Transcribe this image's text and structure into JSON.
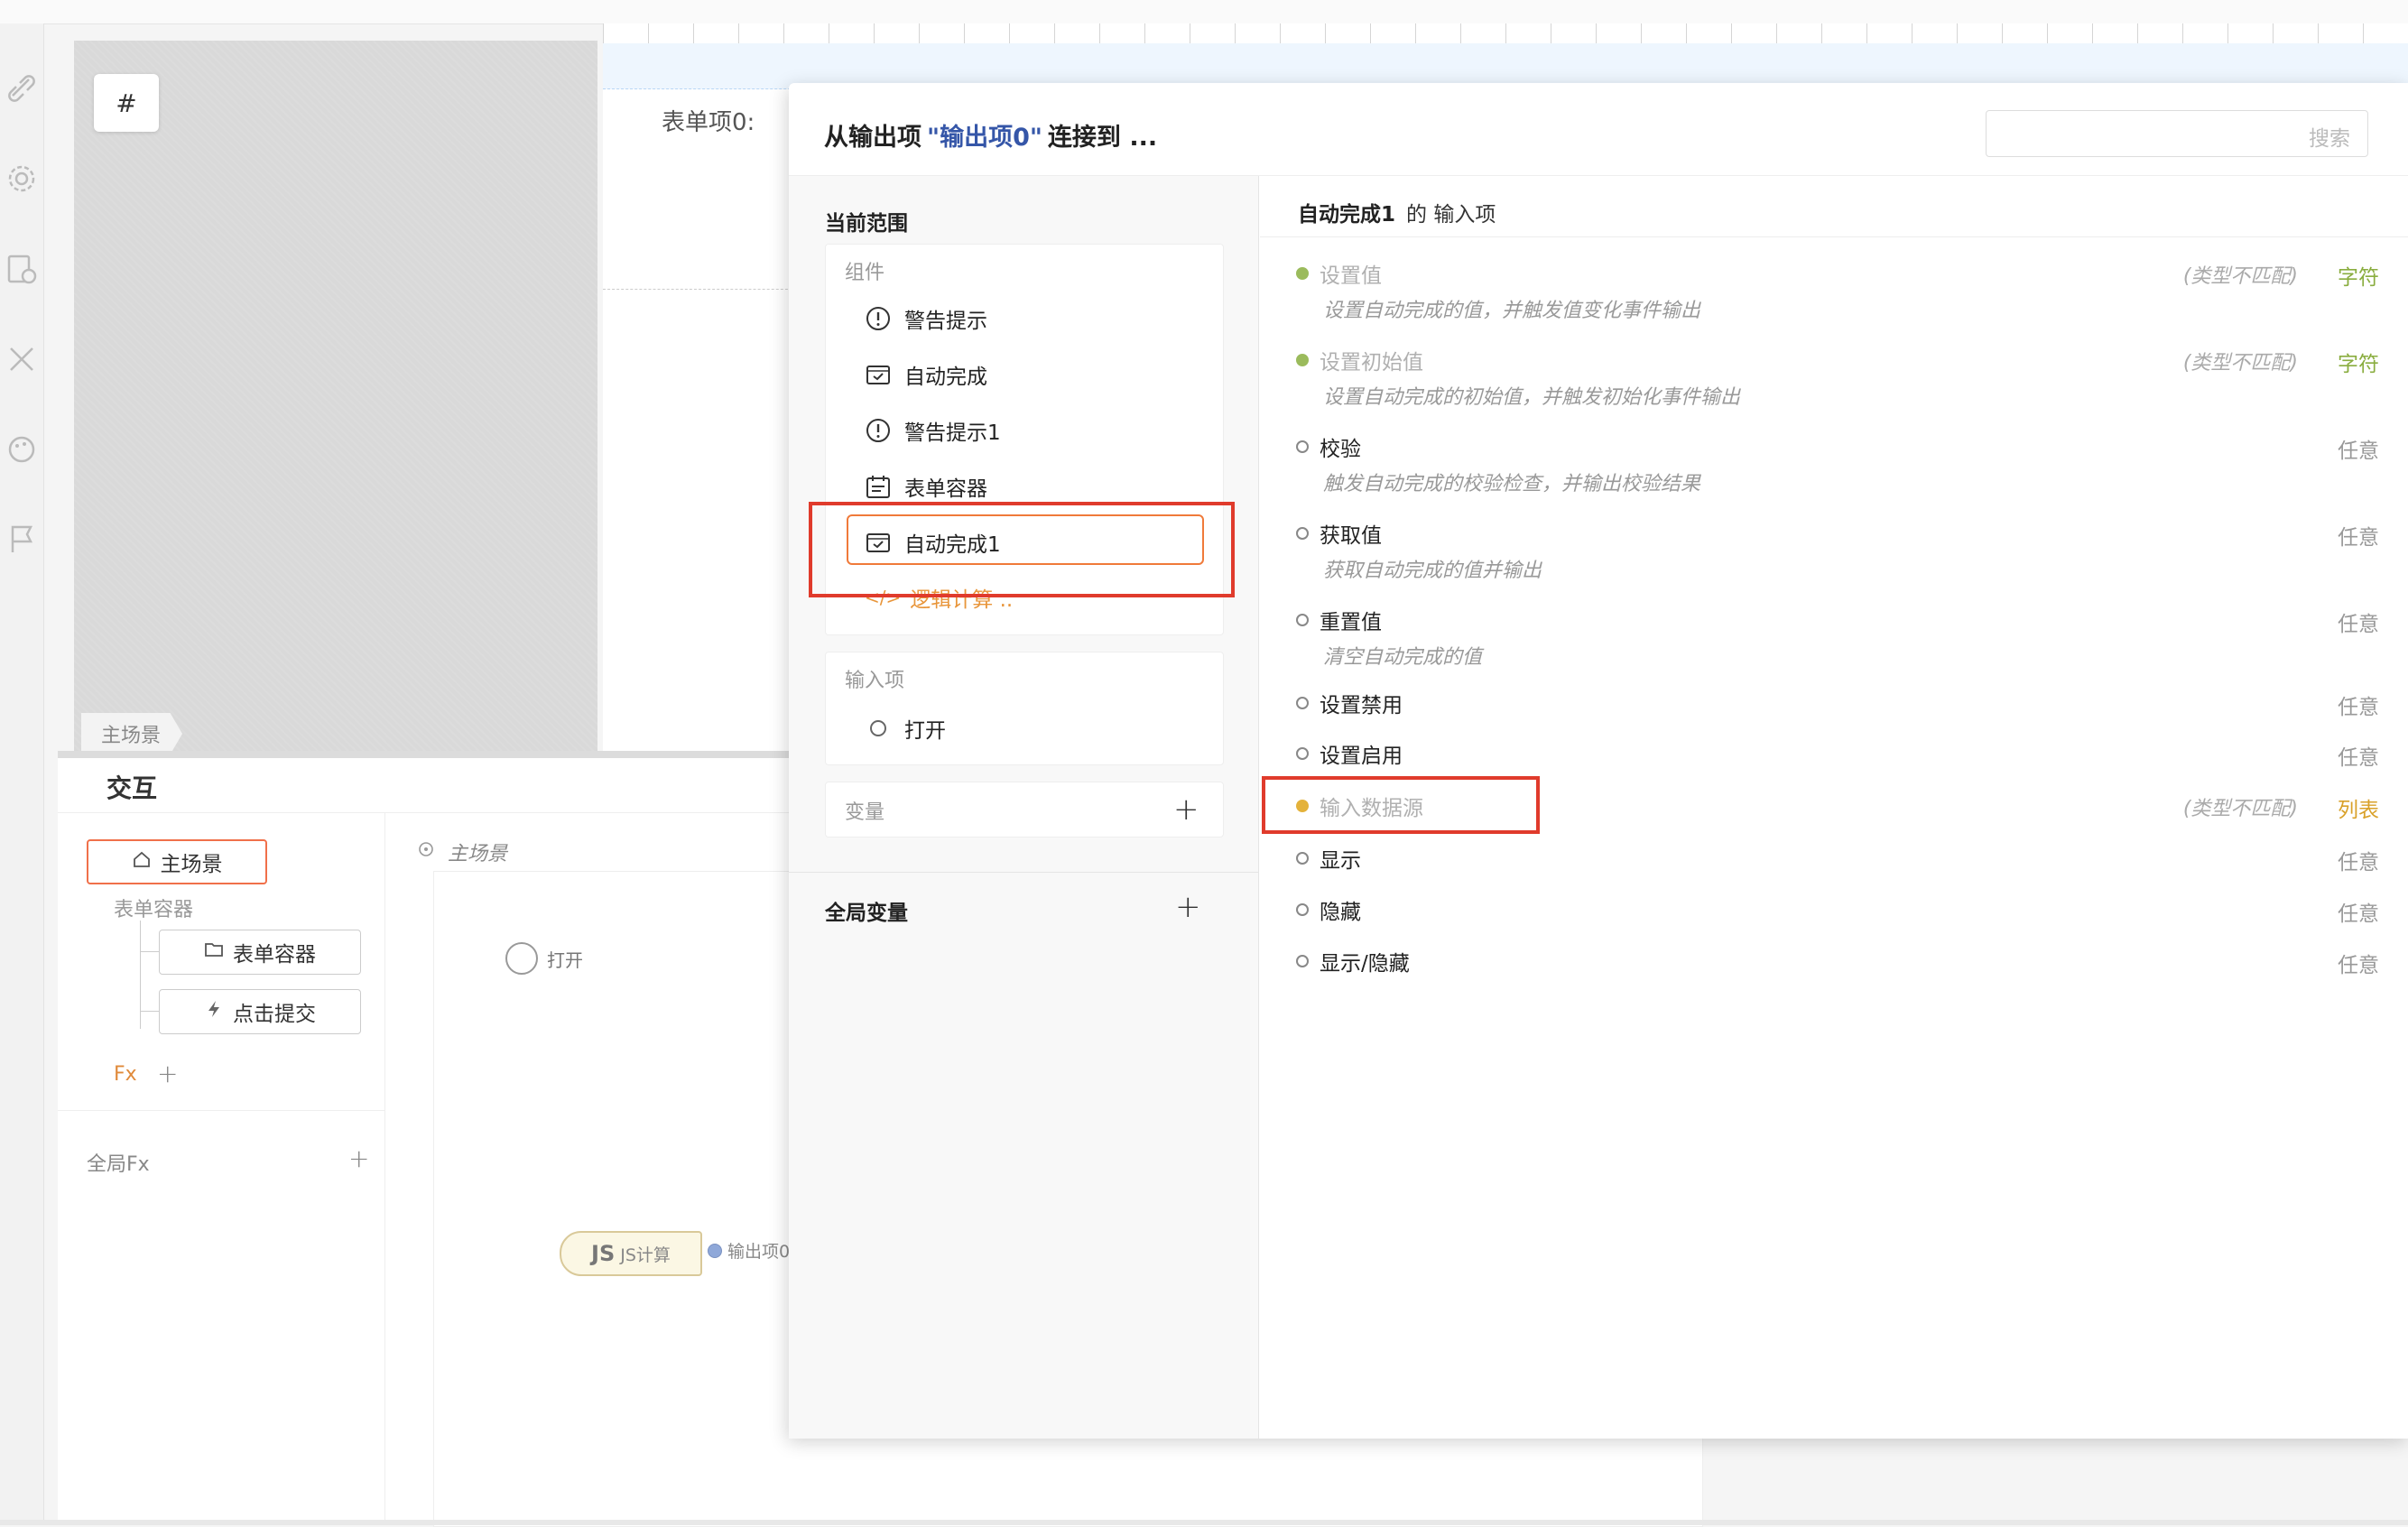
{
  "canvas": {
    "hash_label": "#",
    "scene_tab": "主场景",
    "form_label": "表单项0:"
  },
  "interaction": {
    "title": "交互",
    "tree": {
      "main_scene": "主场景",
      "group_label": "表单容器",
      "child_container": "表单容器",
      "child_submit": "点击提交",
      "fx_label": "Fx",
      "global_fx_label": "全局Fx"
    },
    "graph": {
      "scene_label": "主场景",
      "open_node": "打开",
      "js_badge": "JS",
      "js_label": "JS计算",
      "output_label": "输出项0"
    }
  },
  "dialog": {
    "title_prefix": "从输出项",
    "title_highlight": "\"输出项0\"",
    "title_suffix": "连接到 ...",
    "search_placeholder": "搜索",
    "left": {
      "scope_title": "当前范围",
      "components_label": "组件",
      "components": [
        {
          "label": "警告提示",
          "icon": "alert-circle-icon"
        },
        {
          "label": "自动完成",
          "icon": "autocomplete-icon"
        },
        {
          "label": "警告提示1",
          "icon": "alert-circle-icon"
        },
        {
          "label": "表单容器",
          "icon": "calendar-form-icon"
        },
        {
          "label": "自动完成1",
          "icon": "autocomplete-icon"
        }
      ],
      "logic_item": "逻辑计算 ..",
      "inputs_label": "输入项",
      "input_open": "打开",
      "variables_label": "变量",
      "global_vars_title": "全局变量"
    },
    "right": {
      "target_name": "自动完成1",
      "target_suffix": "的 输入项",
      "items": [
        {
          "name": "设置值",
          "desc": "设置自动完成的值，并触发值变化事件输出",
          "mismatch": "(类型不匹配)",
          "type": "字符",
          "state": "green"
        },
        {
          "name": "设置初始值",
          "desc": "设置自动完成的初始值，并触发初始化事件输出",
          "mismatch": "(类型不匹配)",
          "type": "字符",
          "state": "green"
        },
        {
          "name": "校验",
          "desc": "触发自动完成的校验检查，并输出校验结果",
          "mismatch": "",
          "type": "任意",
          "state": "normal"
        },
        {
          "name": "获取值",
          "desc": "获取自动完成的值并输出",
          "mismatch": "",
          "type": "任意",
          "state": "normal"
        },
        {
          "name": "重置值",
          "desc": "清空自动完成的值",
          "mismatch": "",
          "type": "任意",
          "state": "normal"
        },
        {
          "name": "设置禁用",
          "desc": "",
          "mismatch": "",
          "type": "任意",
          "state": "normal"
        },
        {
          "name": "设置启用",
          "desc": "",
          "mismatch": "",
          "type": "任意",
          "state": "normal"
        },
        {
          "name": "输入数据源",
          "desc": "",
          "mismatch": "(类型不匹配)",
          "type": "列表",
          "state": "yellow"
        },
        {
          "name": "显示",
          "desc": "",
          "mismatch": "",
          "type": "任意",
          "state": "normal"
        },
        {
          "name": "隐藏",
          "desc": "",
          "mismatch": "",
          "type": "任意",
          "state": "normal"
        },
        {
          "name": "显示/隐藏",
          "desc": "",
          "mismatch": "",
          "type": "任意",
          "state": "normal"
        }
      ]
    }
  },
  "colors": {
    "accent_orange": "#f07a3a",
    "annotation_red": "#e03b2c",
    "highlight_blue": "#3556a8",
    "type_green": "#8aad3f",
    "type_yellow": "#d9a12a"
  }
}
